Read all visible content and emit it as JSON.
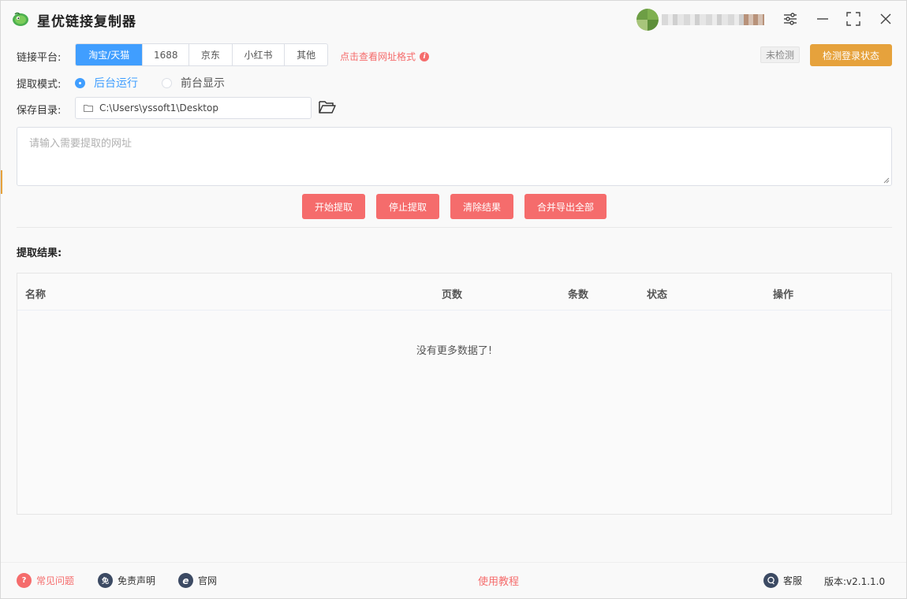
{
  "app": {
    "title": "星优链接复制器",
    "brand_color": "#409eff"
  },
  "header": {
    "icons": [
      "settings-sliders-icon",
      "minimize-icon",
      "maximize-icon",
      "close-icon"
    ]
  },
  "platform": {
    "label": "链接平台:",
    "options": [
      "淘宝/天猫",
      "1688",
      "京东",
      "小红书",
      "其他"
    ],
    "selected": "淘宝/天猫",
    "format_link": "点击查看网址格式",
    "login_status": "未检测",
    "check_button": "检测登录状态"
  },
  "mode": {
    "label": "提取模式:",
    "options": [
      "后台运行",
      "前台显示"
    ],
    "selected": "后台运行"
  },
  "save_dir": {
    "label": "保存目录:",
    "value": "C:\\Users\\yssoft1\\Desktop"
  },
  "url_input": {
    "placeholder": "请输入需要提取的网址",
    "value": ""
  },
  "actions": {
    "start": "开始提取",
    "stop": "停止提取",
    "clear": "清除结果",
    "export": "合并导出全部"
  },
  "results": {
    "title": "提取结果:",
    "columns": [
      "名称",
      "页数",
      "条数",
      "状态",
      "操作"
    ],
    "empty_text": "没有更多数据了!"
  },
  "footer": {
    "faq": "常见问题",
    "disclaimer": "免责声明",
    "disclaimer_badge": "免",
    "website": "官网",
    "tutorial": "使用教程",
    "support": "客服",
    "version": "版本:v2.1.1.0"
  },
  "colors": {
    "primary": "#409eff",
    "danger": "#f56c6c",
    "warning": "#e6a23c"
  }
}
